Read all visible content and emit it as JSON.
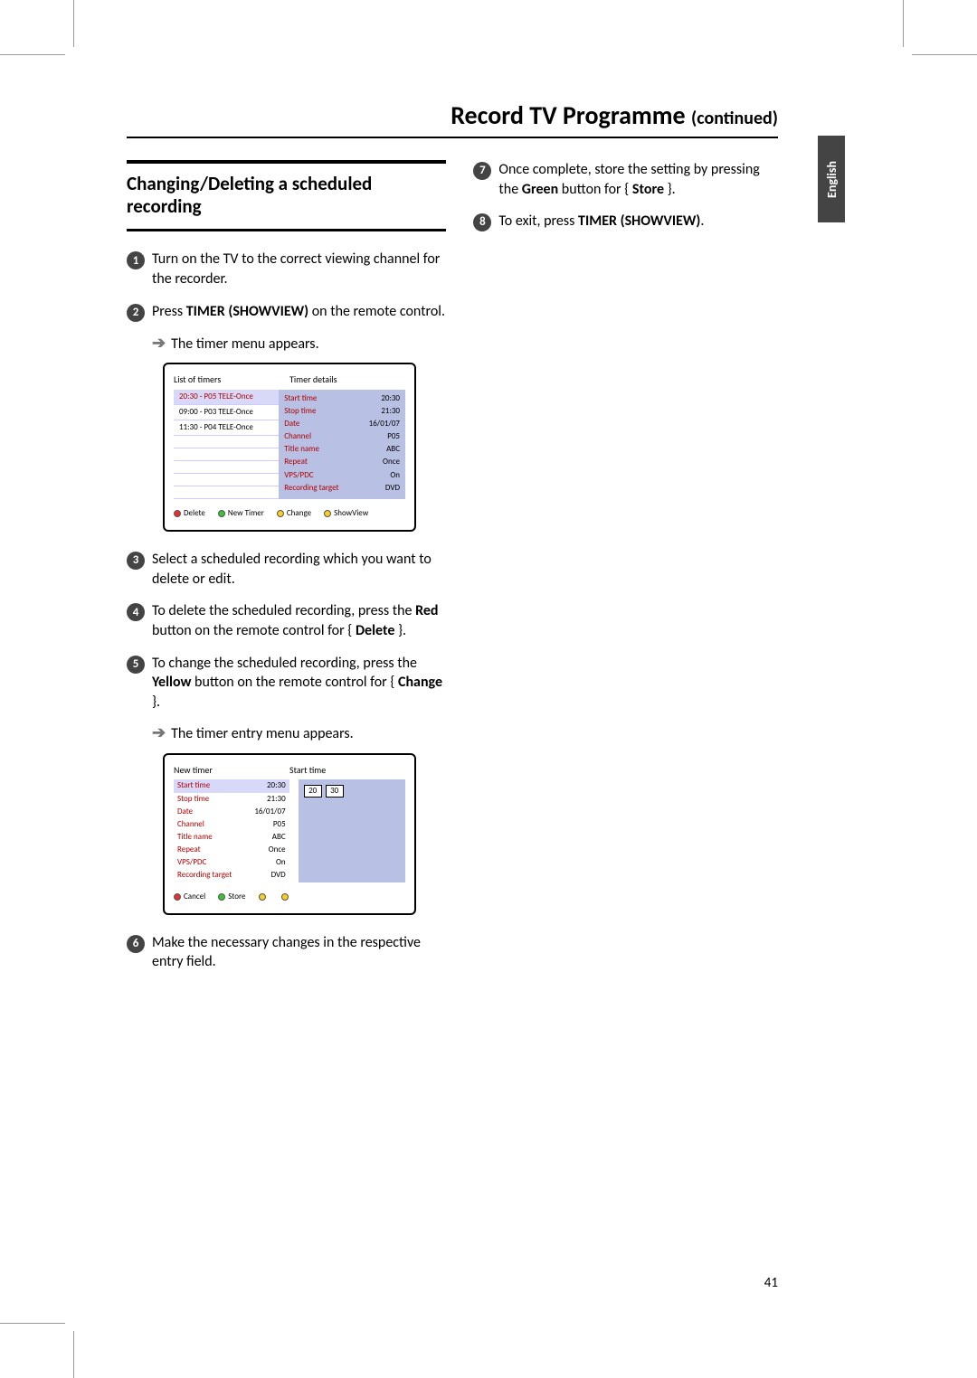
{
  "page_title_main": "Record TV Programme",
  "page_title_suffix": "(continued)",
  "language_tab": "English",
  "page_number": "41",
  "section_heading": "Changing/Deleting a scheduled recording",
  "steps_left": [
    {
      "n": "1",
      "html": "Turn on the TV to the correct viewing channel for the recorder."
    },
    {
      "n": "2",
      "html": "Press <b>TIMER (SHOWVIEW)</b> on the remote control."
    }
  ],
  "substep_a": "The timer menu appears.",
  "steps_left_b": [
    {
      "n": "3",
      "html": "Select a scheduled recording which you want to delete or edit."
    },
    {
      "n": "4",
      "html": "To delete the scheduled recording, press the <b>Red</b> button on the remote control for { <b>Delete</b> }."
    },
    {
      "n": "5",
      "html": "To change the scheduled recording, press the <b>Yellow</b> button on the remote control for { <b>Change</b> }."
    }
  ],
  "substep_b": "The timer entry menu appears.",
  "steps_left_c": [
    {
      "n": "6",
      "html": "Make the necessary changes in the respective entry field."
    }
  ],
  "steps_right": [
    {
      "n": "7",
      "html": "Once complete, store the setting by pressing the <b>Green</b> button for { <b>Store</b> }."
    },
    {
      "n": "8",
      "html": "To exit, press <b>TIMER (SHOWVIEW)</b>."
    }
  ],
  "ui1": {
    "header_left": "List of timers",
    "header_right": "Timer details",
    "list": [
      "20:30 - P05 TELE-Once",
      "09:00 - P03 TELE-Once",
      "11:30 - P04 TELE-Once"
    ],
    "details": [
      [
        "Start time",
        "20:30"
      ],
      [
        "Stop time",
        "21:30"
      ],
      [
        "Date",
        "16/01/07"
      ],
      [
        "Channel",
        "P05"
      ],
      [
        "Title name",
        "ABC"
      ],
      [
        "Repeat",
        "Once"
      ],
      [
        "VPS/PDC",
        "On"
      ],
      [
        "Recording target",
        "DVD"
      ]
    ],
    "footer": [
      [
        "red",
        "Delete"
      ],
      [
        "green",
        "New Timer"
      ],
      [
        "yellow",
        "Change"
      ],
      [
        "yellow",
        "ShowView"
      ]
    ]
  },
  "ui2": {
    "header_left": "New timer",
    "header_right": "Start time",
    "left_rows": [
      [
        "Start time",
        "20:30"
      ],
      [
        "Stop time",
        "21:30"
      ],
      [
        "Date",
        "16/01/07"
      ],
      [
        "Channel",
        "P05"
      ],
      [
        "Title name",
        "ABC"
      ],
      [
        "Repeat",
        "Once"
      ],
      [
        "VPS/PDC",
        "On"
      ],
      [
        "Recording target",
        "DVD"
      ]
    ],
    "right_cells": [
      "20",
      "30"
    ],
    "footer": [
      [
        "red",
        "Cancel"
      ],
      [
        "green",
        "Store"
      ],
      [
        "yellow",
        ""
      ],
      [
        "yellow",
        ""
      ]
    ]
  }
}
